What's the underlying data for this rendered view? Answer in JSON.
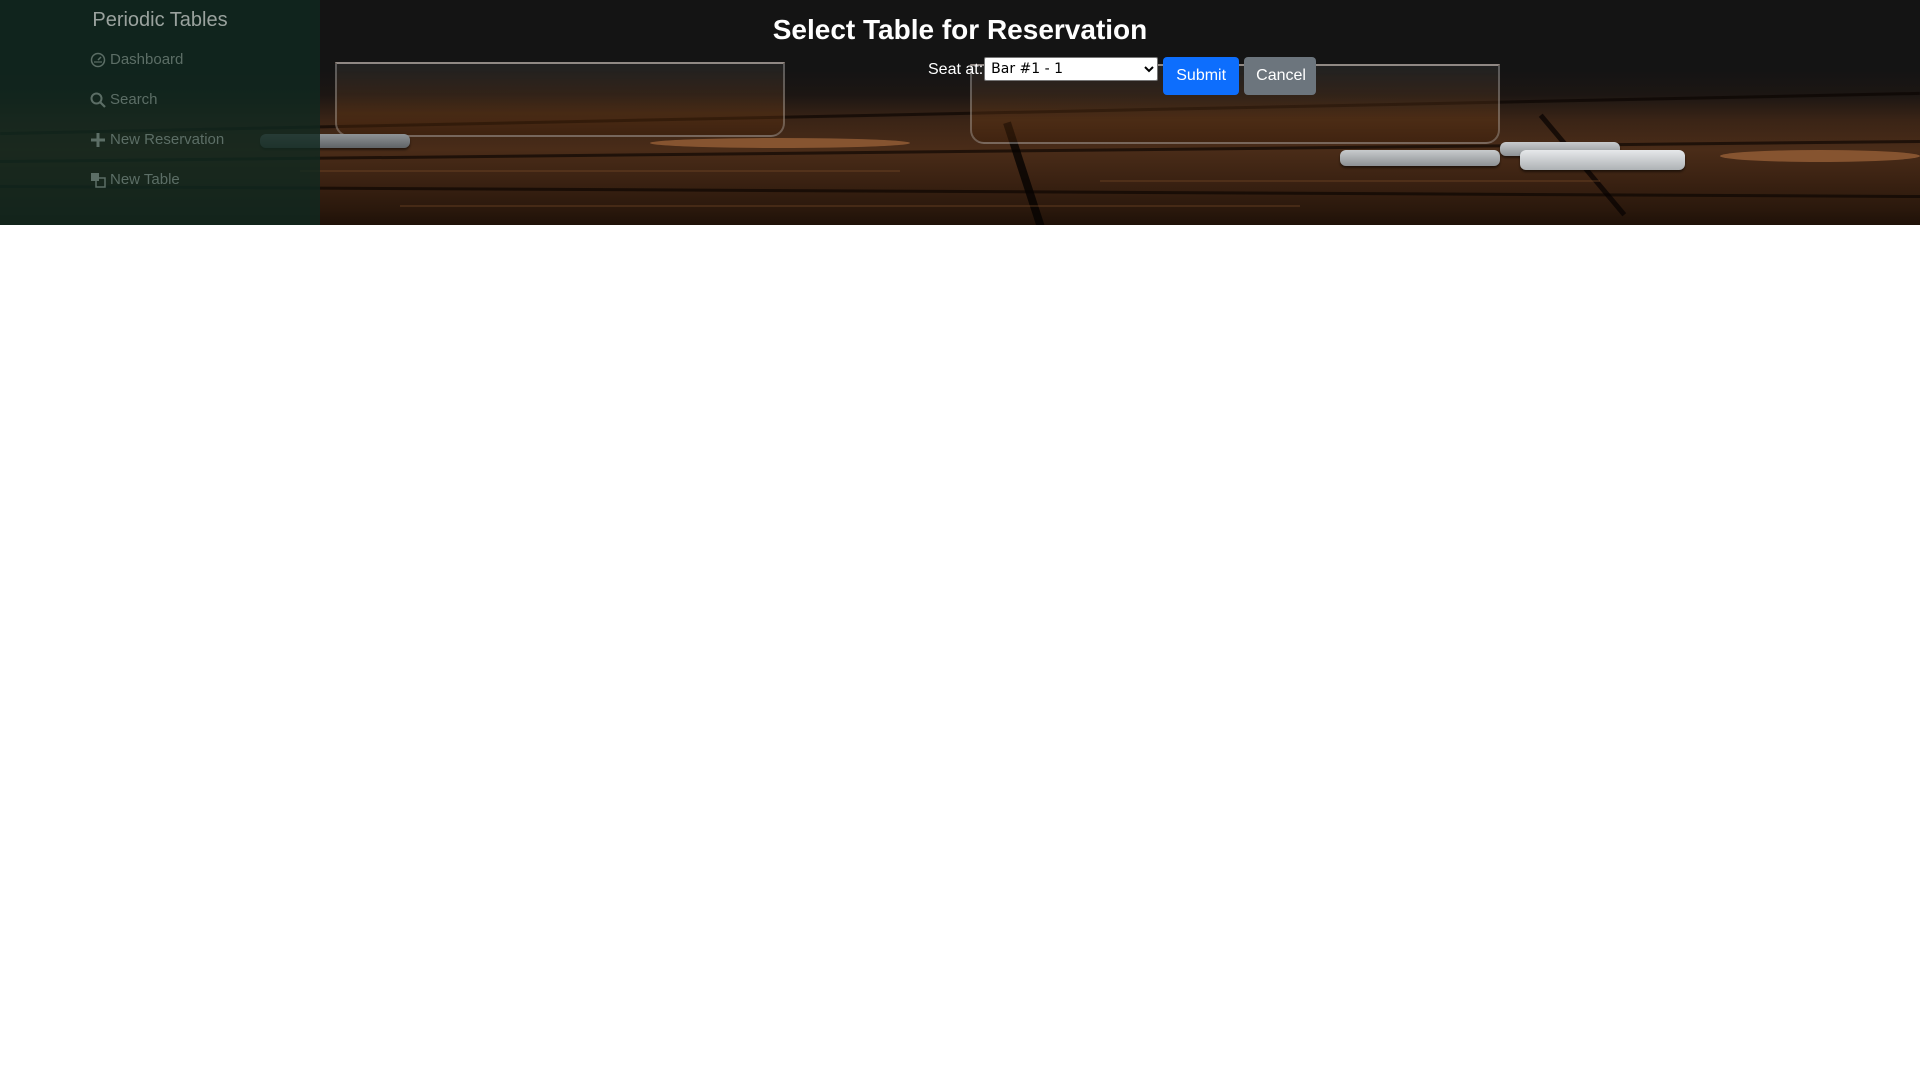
{
  "sidebar": {
    "brand": "Periodic Tables",
    "items": [
      {
        "label": "Dashboard",
        "icon": "dashboard-icon"
      },
      {
        "label": "Search",
        "icon": "search-icon"
      },
      {
        "label": "New Reservation",
        "icon": "plus-icon"
      },
      {
        "label": "New Table",
        "icon": "table-layers-icon"
      }
    ]
  },
  "form": {
    "title": "Select Table for Reservation",
    "seat_label": "Seat at:",
    "selected_table": "Bar #1 - 1",
    "submit_label": "Submit",
    "cancel_label": "Cancel"
  },
  "colors": {
    "primary": "#0d6efd",
    "secondary": "#6c757d",
    "sidebar": "#10281f"
  }
}
